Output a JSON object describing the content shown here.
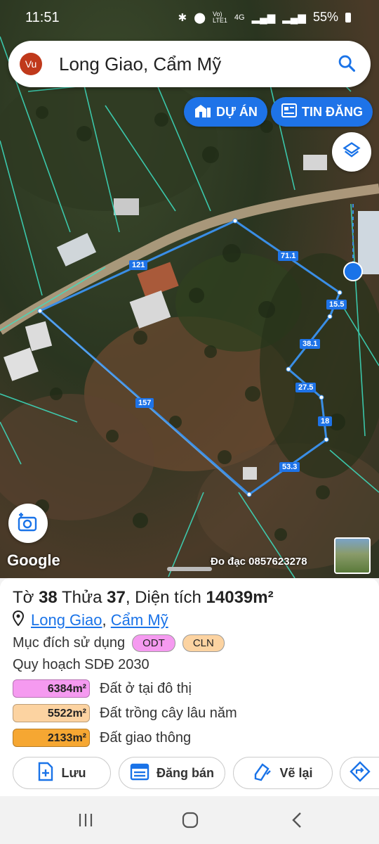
{
  "status": {
    "time": "11:51",
    "network_small": "Vo)\nLTE1",
    "network_type": "4G",
    "battery": "55%"
  },
  "search": {
    "avatar_initials": "Vu",
    "title": "Long Giao, Cẩm Mỹ"
  },
  "buttons": {
    "du_an": "DỰ ÁN",
    "tin_dang": "TIN ĐĂNG"
  },
  "map": {
    "google_label": "Google",
    "survey_label": "Đo đạc 0857623278",
    "segment_lengths": [
      "121",
      "71.1",
      "15.5",
      "38.1",
      "27.5",
      "18",
      "53.3",
      "157"
    ]
  },
  "parcel": {
    "sheet_label": "Tờ",
    "sheet_no": "38",
    "plot_label": "Thửa",
    "plot_no": "37",
    "area_label": ", Diện tích",
    "area_value": "14039m²",
    "commune": "Long Giao",
    "separator": ",",
    "district": "Cẩm Mỹ",
    "purpose_label": "Mục đích sử dụng",
    "purpose_tags": [
      {
        "code": "ODT",
        "color": "#f59af0"
      },
      {
        "code": "CLN",
        "color": "#fcd3a1"
      }
    ],
    "plan_label": "Quy hoạch SDĐ 2030",
    "plan": [
      {
        "area": "6384m²",
        "desc": "Đất ở tại đô thị",
        "color": "#f59af0"
      },
      {
        "area": "5522m²",
        "desc": "Đất trồng cây lâu năm",
        "color": "#fcd3a1"
      },
      {
        "area": "2133m²",
        "desc": "Đất giao thông",
        "color": "#f6a732"
      }
    ]
  },
  "actions": {
    "save": "Lưu",
    "sell": "Đăng bán",
    "redraw": "Vẽ lại"
  },
  "colors": {
    "accent": "#1e73e8",
    "link": "#1a73e8",
    "boundary": "#3a8ee6"
  }
}
